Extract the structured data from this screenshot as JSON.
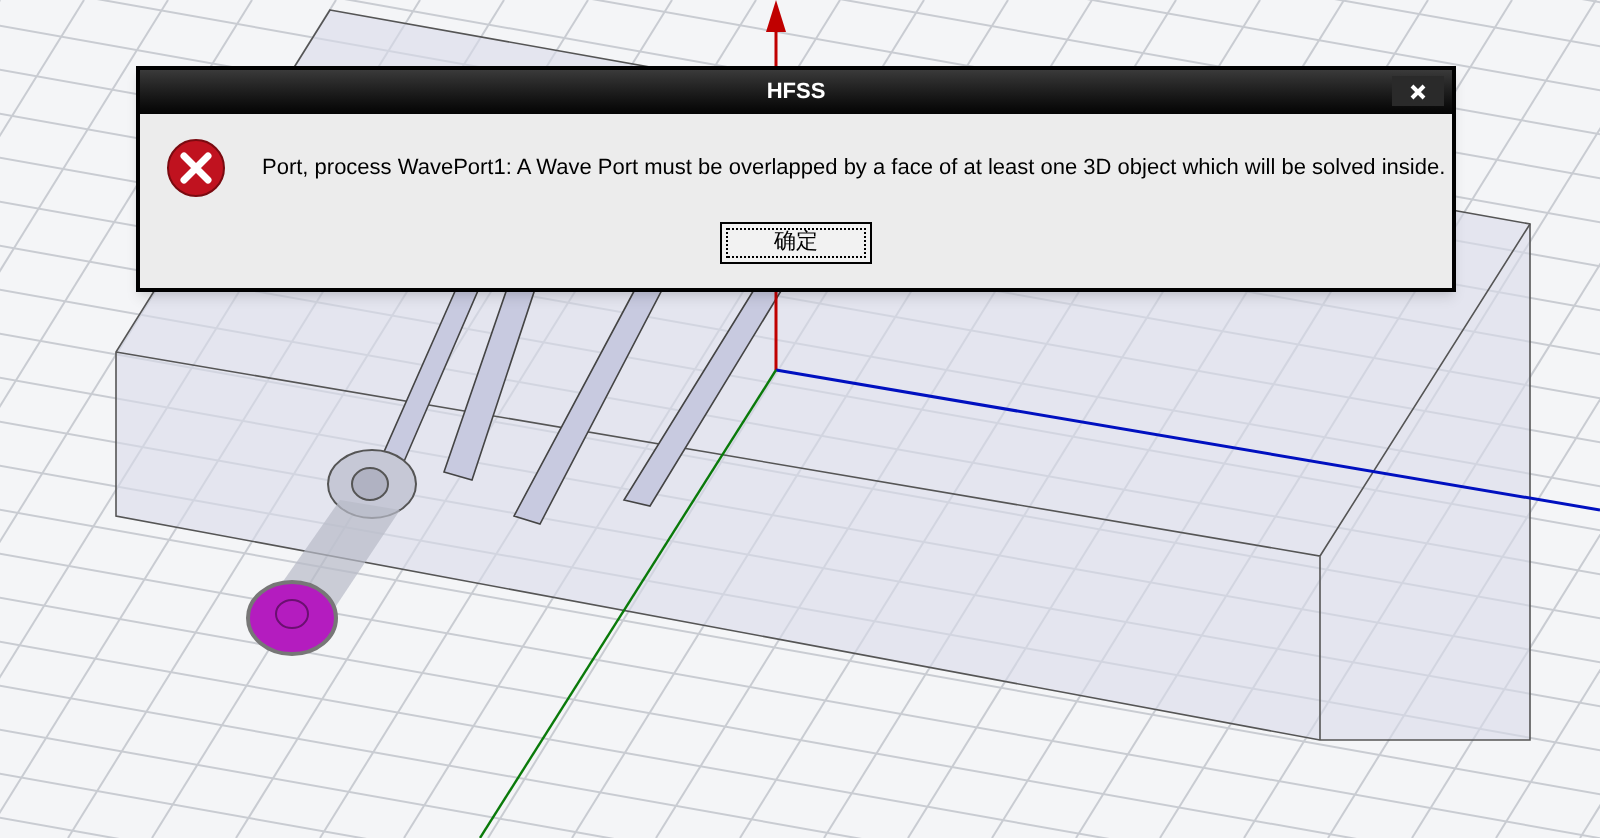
{
  "dialog": {
    "title": "HFSS",
    "message": "Port, process WavePort1: A Wave Port must be overlapped by a face of at least one 3D object which will be solved inside.",
    "buttons": [
      {
        "label": "确定",
        "focused": true
      }
    ]
  }
}
